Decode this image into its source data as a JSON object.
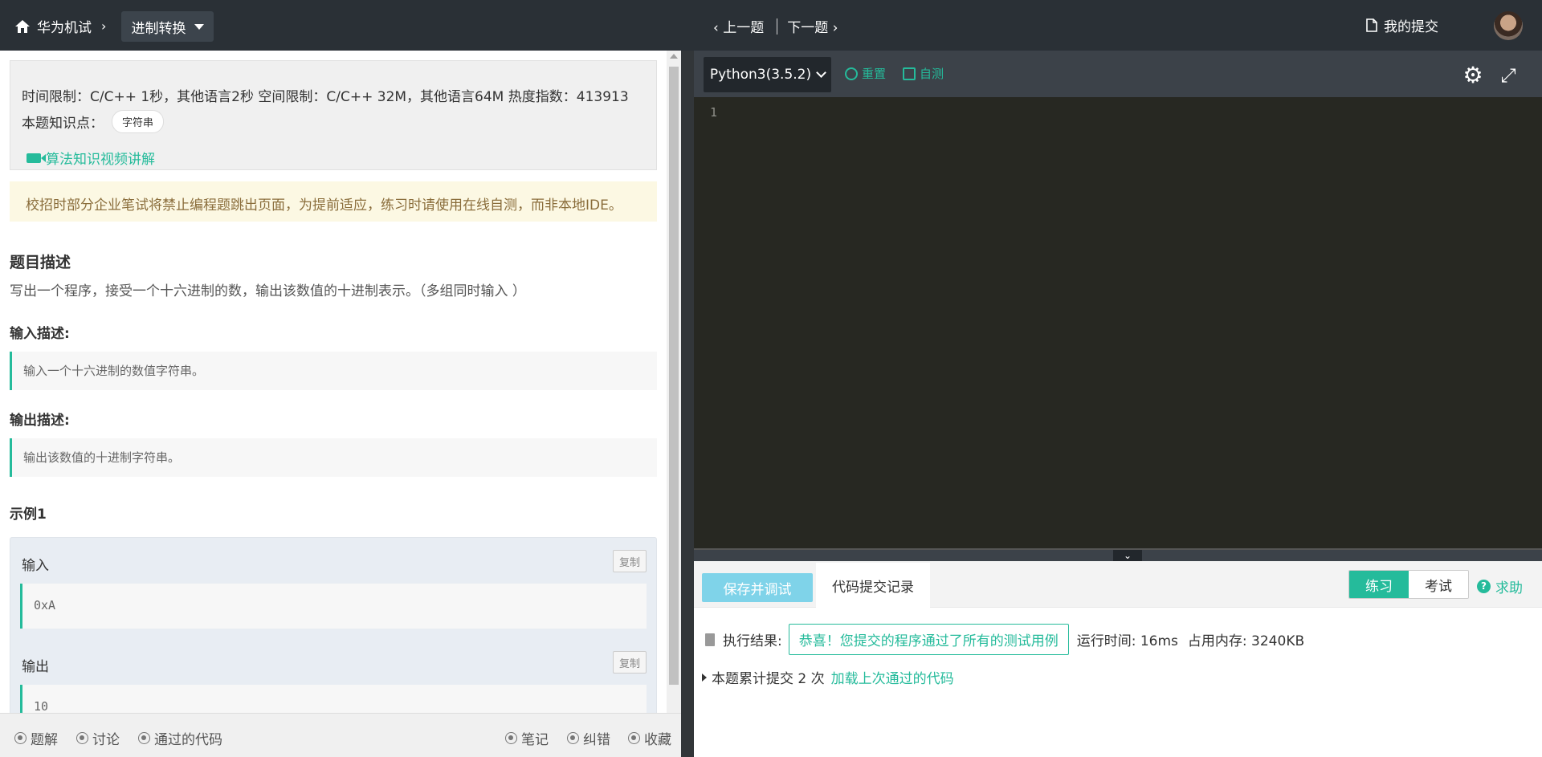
{
  "topbar": {
    "home_label": "华为机试",
    "category_label": "进制转换",
    "prev_label": "上一题",
    "next_label": "下一题",
    "my_submissions_label": "我的提交"
  },
  "problem": {
    "limits": "时间限制：C/C++ 1秒，其他语言2秒    空间限制：C/C++ 32M，其他语言64M    热度指数：413913",
    "knowledge_label": "本题知识点：",
    "knowledge_tag": "字符串",
    "video_link": "算法知识视频讲解",
    "notice": "校招时部分企业笔试将禁止编程题跳出页面，为提前适应，练习时请使用在线自测，而非本地IDE。",
    "desc_title": "题目描述",
    "desc_text": "写出一个程序，接受一个十六进制的数，输出该数值的十进制表示。（多组同时输入 ）",
    "input_title": "输入描述:",
    "input_text": "输入一个十六进制的数值字符串。",
    "output_title": "输出描述:",
    "output_text": "输出该数值的十进制字符串。",
    "example_title": "示例1",
    "example": {
      "input_label": "输入",
      "input_value": "0xA",
      "output_label": "输出",
      "output_value": "10",
      "copy_label": "复制"
    }
  },
  "left_bottom": {
    "solutions": "题解",
    "discuss": "讨论",
    "passed_code": "通过的代码",
    "notes": "笔记",
    "errata": "纠错",
    "favorite": "收藏"
  },
  "editor": {
    "language": "Python3(3.5.2)",
    "reset_label": "重置",
    "self_test_label": "自测",
    "line_number": "1"
  },
  "result": {
    "save_debug_label": "保存并调试",
    "records_tab": "代码提交记录",
    "mode_practice": "练习",
    "mode_exam": "考试",
    "help_label": "求助",
    "exec_label": "执行结果:",
    "success_text": "恭喜！您提交的程序通过了所有的测试用例",
    "run_time": "运行时间: 16ms",
    "memory": "占用内存: 3240KB",
    "submit_count_text": "本题累计提交 2 次",
    "load_last_link": "加载上次通过的代码"
  },
  "colors": {
    "accent": "#25bb9b",
    "topbar_bg": "#2a3036",
    "editor_bg": "#272822",
    "notice_bg": "#fcf8e3"
  },
  "icons": [
    "home-icon",
    "chevron-right-icon",
    "caret-down-icon",
    "chevron-left-icon",
    "file-icon",
    "video-icon",
    "refresh-icon",
    "monitor-icon",
    "gear-icon",
    "expand-icon",
    "clipboard-icon",
    "help-icon"
  ]
}
